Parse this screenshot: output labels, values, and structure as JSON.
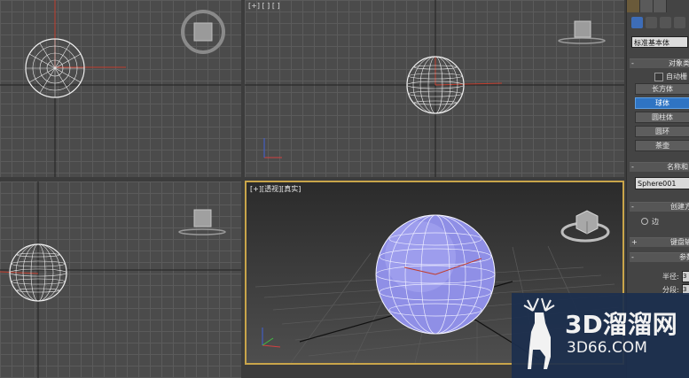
{
  "viewports": {
    "top": {
      "label": ""
    },
    "front": {
      "label": "[+] [ ] [ ]"
    },
    "left": {
      "label": ""
    },
    "perspective": {
      "label": "[+][透视][真实]"
    }
  },
  "command_panel": {
    "category_dropdown": "标准基本体",
    "object_type": {
      "header": "对象类",
      "autogrid_label": "自动栅",
      "buttons": [
        "长方体",
        "球体",
        "圆柱体",
        "圆环",
        "茶壶"
      ],
      "selected": "球体"
    },
    "name_color": {
      "header": "名称和",
      "name_value": "Sphere001"
    },
    "creation_method": {
      "header": "创建方",
      "option_label": "边"
    },
    "keyboard_entry": {
      "header": "键盘输"
    },
    "parameters": {
      "header": "参数",
      "radius_label": "半径:",
      "radius_value": "3",
      "segments_label": "分段:",
      "segments_value": "3"
    }
  },
  "watermark": {
    "title": "3D溜溜网",
    "url": "3D66.COM"
  },
  "colors": {
    "viewport_bg": "#4b4b4b",
    "grid": "#5b5b5b",
    "active_border": "#c9a54a",
    "selected_button": "#2f74c3",
    "sphere_shaded": "#8f8fe6",
    "watermark_bg": "#1c2f4e"
  }
}
